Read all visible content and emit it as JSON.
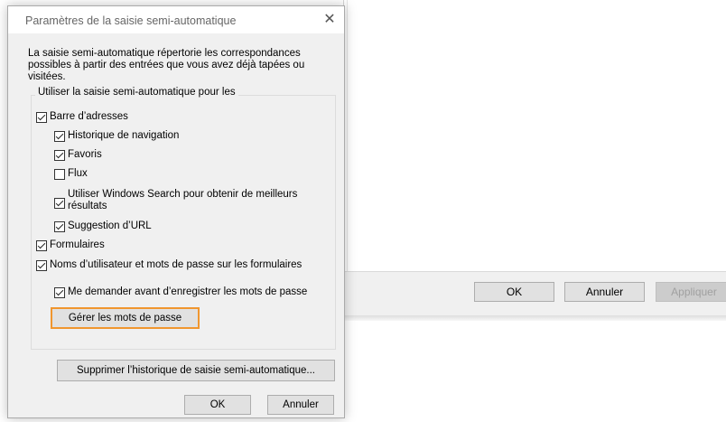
{
  "background_window": {
    "buttons": {
      "ok": "OK",
      "cancel": "Annuler",
      "apply": "Appliquer"
    }
  },
  "dialog": {
    "title": "Paramètres de la saisie semi-automatique",
    "close_glyph": "✕",
    "description": "La saisie semi-automatique répertorie les correspondances possibles à partir des entrées que vous avez déjà tapées ou visitées.",
    "group_label": "Utiliser la saisie semi-automatique pour les",
    "options": {
      "address_bar": {
        "label": "Barre d’adresses",
        "checked": true
      },
      "history": {
        "label": "Historique de navigation",
        "checked": true
      },
      "favorites": {
        "label": "Favoris",
        "checked": true
      },
      "feeds": {
        "label": "Flux",
        "checked": false
      },
      "windows_search": {
        "label": "Utiliser Windows Search pour obtenir de meilleurs résultats",
        "checked": true
      },
      "url_suggestion": {
        "label": "Suggestion d’URL",
        "checked": true
      },
      "forms": {
        "label": "Formulaires",
        "checked": true
      },
      "usernames_passwords": {
        "label": "Noms d’utilisateur et mots de passe sur les formulaires",
        "checked": true
      },
      "ask_before_saving": {
        "label": "Me demander avant d’enregistrer les mots de passe",
        "checked": true
      }
    },
    "manage_passwords_button": "Gérer les mots de passe",
    "delete_history_button": "Supprimer l’historique de saisie semi-automatique...",
    "ok_button": "OK",
    "cancel_button": "Annuler"
  }
}
